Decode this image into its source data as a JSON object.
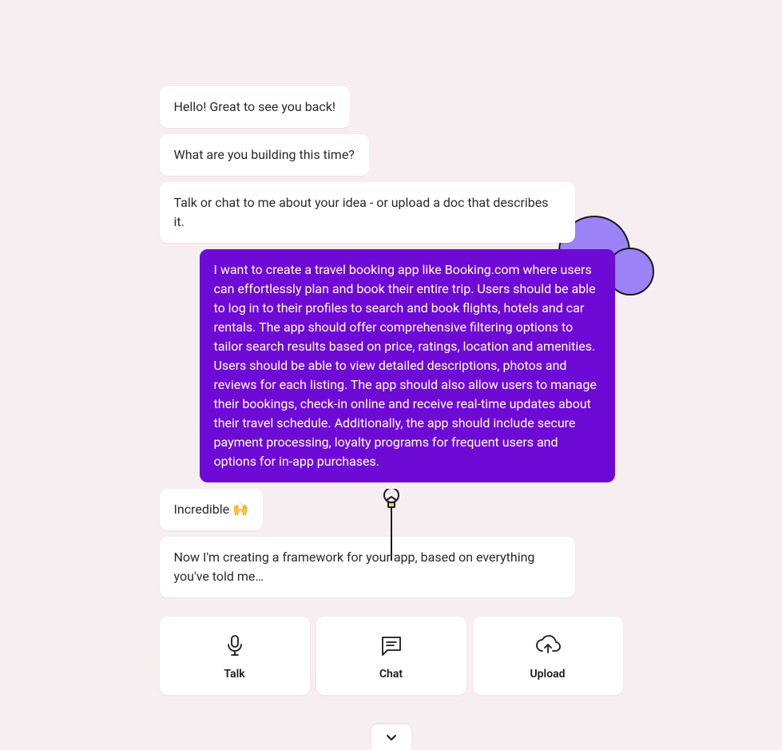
{
  "messages": [
    {
      "role": "bot",
      "text": "Hello! Great to see you back!"
    },
    {
      "role": "bot",
      "text": "What are you building this time?"
    },
    {
      "role": "bot",
      "text": "Talk or chat to me about your idea - or upload a doc that describes it."
    },
    {
      "role": "user",
      "text": "I want to create a travel booking app like Booking.com where users can effortlessly plan and book their entire trip. Users should be able to log in to their profiles to search and book flights, hotels and car rentals. The app should offer comprehensive filtering options to tailor search results based on price, ratings, location and amenities. Users should be able to view detailed descriptions, photos and reviews for each listing. The app should also allow users to manage their bookings, check-in online and receive real-time updates about their travel schedule. Additionally, the app should include secure payment processing, loyalty programs for frequent users and options for in-app purchases."
    },
    {
      "role": "bot",
      "text": "Incredible 🙌"
    },
    {
      "role": "bot",
      "text": "Now I'm creating a framework for your app, based on everything you've told me…"
    }
  ],
  "actions": {
    "talk": {
      "label": "Talk"
    },
    "chat": {
      "label": "Chat"
    },
    "upload": {
      "label": "Upload"
    }
  },
  "colors": {
    "background": "#f7eef1",
    "bot_bubble": "#ffffff",
    "user_bubble": "#6e0ad6",
    "accent_cloud": "#9b82f7"
  }
}
